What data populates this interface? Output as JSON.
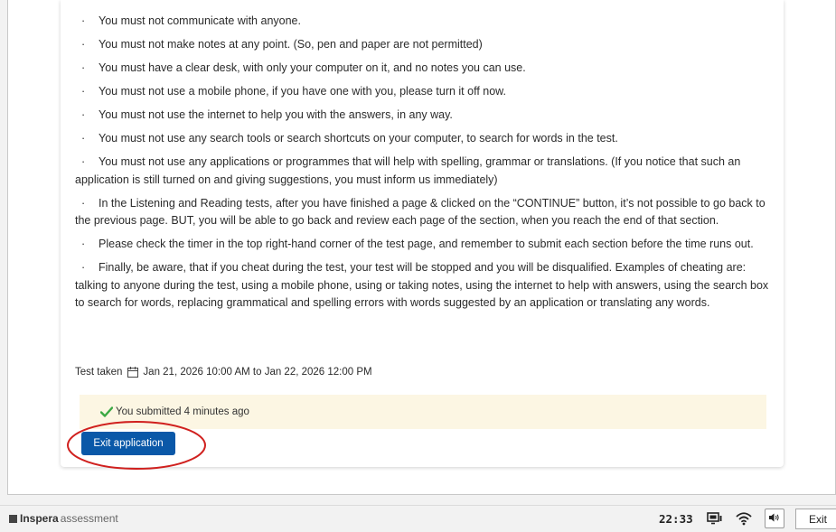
{
  "rules": [
    {
      "bullet": "·",
      "text": "You must not communicate with anyone."
    },
    {
      "bullet": "·",
      "text": "You must not make notes at any point. (So, pen and paper are not permitted)"
    },
    {
      "bullet": "·",
      "text": "You must have a clear desk, with only your computer on it, and no notes you can use."
    },
    {
      "bullet": "·",
      "text": "You must not use a mobile phone, if you have one with you, please turn it off now."
    },
    {
      "bullet": "·",
      "text": "You must not use the internet to help you with the answers, in any way."
    },
    {
      "bullet": "·",
      "text": "You must not use any search tools or search shortcuts on your computer, to search for words in the test."
    },
    {
      "bullet": "·",
      "text": "You must not use any applications or programmes that will help with spelling, grammar or translations. (If you notice that such an application is still turned on and giving suggestions, you must inform us immediately)"
    },
    {
      "bullet": "·",
      "text": "In the Listening and Reading tests, after you have finished a page & clicked on the “CONTINUE” button, it’s not possible to go back to the previous page. BUT, you will be able to go back and review each page of the section, when you reach the end of that section."
    },
    {
      "bullet": "·",
      "text": "Please check the timer in the top right-hand corner of the test page, and remember to submit each section before the time runs out."
    },
    {
      "bullet": "·",
      "text": "Finally, be aware, that if you cheat during the test, your test will be stopped and you will be disqualified.  Examples of cheating are: talking to anyone during the test, using a mobile phone, using or taking notes, using the internet to help with answers, using the search box to search for words, replacing grammatical and spelling errors with words suggested by an application or translating any words."
    }
  ],
  "test_taken": {
    "label": "Test taken",
    "icon": "calendar-icon",
    "range": "Jan 21, 2026 10:00 AM to Jan 22, 2026 12:00 PM"
  },
  "submission": {
    "icon": "checkmark-icon",
    "text": "You submitted 4 minutes ago",
    "background": "#fcf6e3",
    "check_color": "#3aa843"
  },
  "exit_application": {
    "label": "Exit application",
    "color": "#0a58a8"
  },
  "annotation": {
    "shape": "ellipse",
    "color": "#d0201e"
  },
  "taskbar": {
    "brand_bold": "Inspera",
    "brand_rest": "assessment",
    "clock": "22:33",
    "icons": [
      "screen-icon",
      "wifi-icon",
      "volume-icon"
    ],
    "exit_label": "Exit"
  }
}
